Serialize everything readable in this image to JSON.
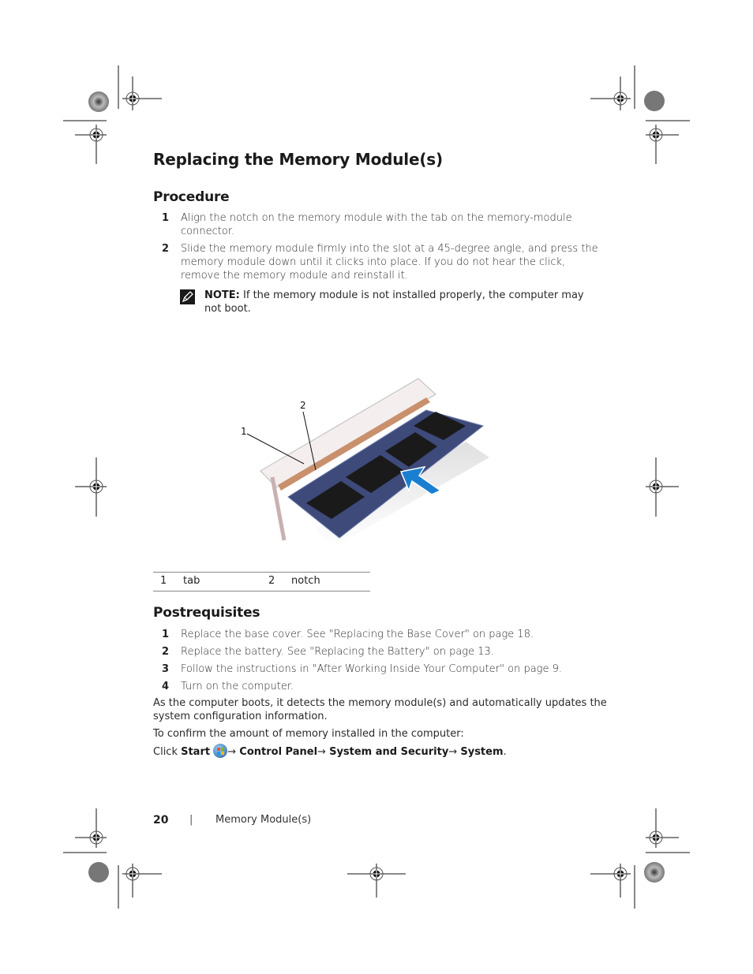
{
  "page": {
    "title": "Replacing the Memory Module(s)",
    "procedure": {
      "heading": "Procedure",
      "steps": [
        {
          "num": "1",
          "text": "Align the notch on the memory module with the tab on the memory-module connector."
        },
        {
          "num": "2",
          "text": "Slide the memory module firmly into the slot at a 45-degree angle, and press the memory module down until it clicks into place. If you do not hear the click, remove the memory module and reinstall it."
        }
      ],
      "note": {
        "icon": "pencil-note-icon",
        "label": "NOTE:",
        "text": " If the memory module is not installed properly, the computer may not boot."
      }
    },
    "figure": {
      "callouts": [
        "1",
        "2"
      ],
      "legend": [
        {
          "num": "1",
          "label": "tab"
        },
        {
          "num": "2",
          "label": "notch"
        }
      ],
      "arrow_color": "#1a7fd0"
    },
    "postrequisites": {
      "heading": "Postrequisites",
      "steps": [
        {
          "num": "1",
          "text": "Replace the base cover. See \"Replacing the Base Cover\" on page 18."
        },
        {
          "num": "2",
          "text": "Replace the battery. See \"Replacing the Battery\" on page 13."
        },
        {
          "num": "3",
          "text": "Follow the instructions in \"After Working Inside Your Computer\" on page 9."
        },
        {
          "num": "4",
          "text": "Turn on the computer."
        }
      ],
      "para1": "As the computer boots, it detects the memory module(s) and automatically updates the system configuration information.",
      "para2": "To confirm the amount of memory installed in the computer:",
      "click_path": {
        "prefix": "Click ",
        "start": "Start",
        "start_icon": "windows-start-icon",
        "arrow": "→",
        "control_panel": "Control Panel",
        "system_security": "System and Security",
        "system": "System",
        "end": "."
      }
    },
    "footer": {
      "page_number": "20",
      "separator": "|",
      "section": "Memory Module(s)"
    }
  }
}
